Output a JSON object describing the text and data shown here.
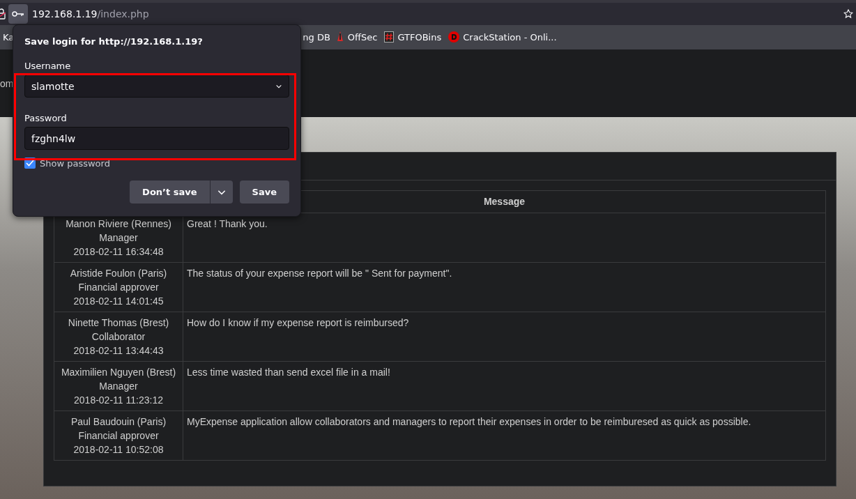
{
  "address_bar": {
    "host": "192.168.1.19",
    "path": "/index.php"
  },
  "bookmarks": [
    {
      "label": "Ka",
      "kind": "plain"
    },
    {
      "label": "ng DB",
      "kind": "plain"
    },
    {
      "label": "OffSec",
      "kind": "flame"
    },
    {
      "label": "GTFOBins",
      "kind": "hash"
    },
    {
      "label": "CrackStation - Onli...",
      "kind": "letter"
    }
  ],
  "nav_fragment": "om",
  "table": {
    "columns": [
      "Message"
    ],
    "rows": [
      {
        "author": "Manon Riviere (Rennes)",
        "role": "Manager",
        "date": "2018-02-11 16:34:48",
        "message": "Great ! Thank you."
      },
      {
        "author": "Aristide Foulon (Paris)",
        "role": "Financial approver",
        "date": "2018-02-11 14:01:45",
        "message": "The status of your expense report will be \" Sent for payment\"."
      },
      {
        "author": "Ninette Thomas (Brest)",
        "role": "Collaborator",
        "date": "2018-02-11 13:44:43",
        "message": "How do I know if my expense report is reimbursed?"
      },
      {
        "author": "Maximilien Nguyen (Brest)",
        "role": "Manager",
        "date": "2018-02-11 11:23:12",
        "message": "Less time wasted than send excel file in a mail!"
      },
      {
        "author": "Paul Baudouin (Paris)",
        "role": "Financial approver",
        "date": "2018-02-11 10:52:08",
        "message": "MyExpense application allow collaborators and managers to report their expenses in order to be reimburesed as quick as possible."
      }
    ]
  },
  "save_login_popup": {
    "title": "Save login for http://192.168.1.19?",
    "username_label": "Username",
    "username": "slamotte",
    "password_label": "Password",
    "password": "fzghn4lw",
    "show_password": {
      "label": "Show password",
      "checked": true
    },
    "buttons": [
      "Don’t save",
      "Save"
    ]
  }
}
